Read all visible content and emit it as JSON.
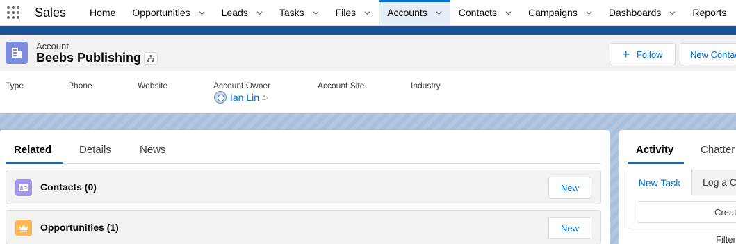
{
  "nav": {
    "app_name": "Sales",
    "items": [
      {
        "label": "Home"
      },
      {
        "label": "Opportunities"
      },
      {
        "label": "Leads"
      },
      {
        "label": "Tasks"
      },
      {
        "label": "Files"
      },
      {
        "label": "Accounts"
      },
      {
        "label": "Contacts"
      },
      {
        "label": "Campaigns"
      },
      {
        "label": "Dashboards"
      },
      {
        "label": "Reports"
      }
    ]
  },
  "record": {
    "type": "Account",
    "title": "Beebs Publishing",
    "actions": {
      "follow": "Follow",
      "new_contact": "New Contact"
    }
  },
  "highlights": {
    "fields": [
      {
        "label": "Type"
      },
      {
        "label": "Phone"
      },
      {
        "label": "Website"
      },
      {
        "label": "Account Owner",
        "value": "Ian Lin"
      },
      {
        "label": "Account Site"
      },
      {
        "label": "Industry"
      }
    ]
  },
  "main_tabs": [
    "Related",
    "Details",
    "News"
  ],
  "related_lists": [
    {
      "title": "Contacts (0)",
      "new_label": "New",
      "icon": "contact-card-icon",
      "color": "#a094ed"
    },
    {
      "title": "Opportunities (1)",
      "new_label": "New",
      "icon": "crown-icon",
      "color": "#fcb95b"
    }
  ],
  "activity": {
    "tabs": [
      "Activity",
      "Chatter"
    ],
    "publisher_tabs": [
      "New Task",
      "Log a Call"
    ],
    "create_placeholder": "Create a task...",
    "filters_label": "Filters"
  },
  "colors": {
    "brand_blue": "#0070d2",
    "header_band": "#1b5297"
  }
}
